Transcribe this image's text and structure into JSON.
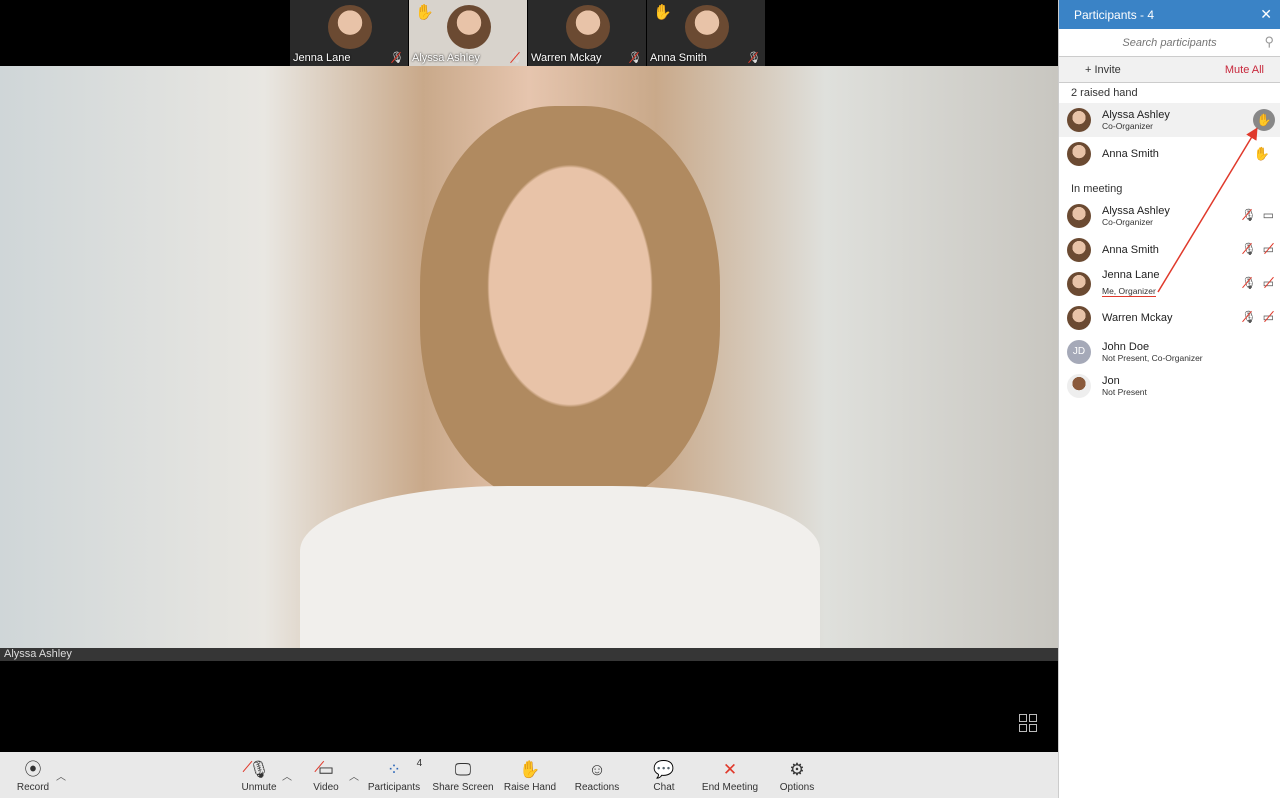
{
  "thumbnails": [
    {
      "name": "Jenna Lane",
      "raised": false
    },
    {
      "name": "Alyssa Ashley",
      "raised": true
    },
    {
      "name": "Warren Mckay",
      "raised": false
    },
    {
      "name": "Anna Smith",
      "raised": true
    }
  ],
  "main_video": {
    "speaker": "Alyssa Ashley"
  },
  "toolbar": {
    "record": "Record",
    "unmute": "Unmute",
    "video": "Video",
    "participants": "Participants",
    "participants_count": "4",
    "share": "Share Screen",
    "raise": "Raise Hand",
    "reactions": "Reactions",
    "chat": "Chat",
    "end": "End Meeting",
    "options": "Options",
    "end_color": "#e0392b"
  },
  "panel": {
    "title": "Participants - 4",
    "search_placeholder": "Search participants",
    "invite": "+  Invite",
    "mute_all": "Mute All",
    "raised_header": "2 raised hand",
    "raised": [
      {
        "name": "Alyssa Ashley",
        "role": "Co-Organizer"
      },
      {
        "name": "Anna Smith",
        "role": ""
      }
    ],
    "meeting_header": "In meeting",
    "meeting": [
      {
        "name": "Alyssa Ashley",
        "role": "Co-Organizer",
        "mic": "muted",
        "video": "on"
      },
      {
        "name": "Anna Smith",
        "role": "",
        "mic": "muted",
        "video": "off"
      },
      {
        "name": "Jenna Lane",
        "role": "Me, Organizer",
        "mic": "muted",
        "video": "off"
      },
      {
        "name": "Warren Mckay",
        "role": "",
        "mic": "muted",
        "video": "off"
      },
      {
        "name": "John Doe",
        "role": "Not Present, Co-Organizer",
        "initials": "JD"
      },
      {
        "name": "Jon",
        "role": "Not Present"
      }
    ],
    "header_color": "#3a83c6"
  }
}
